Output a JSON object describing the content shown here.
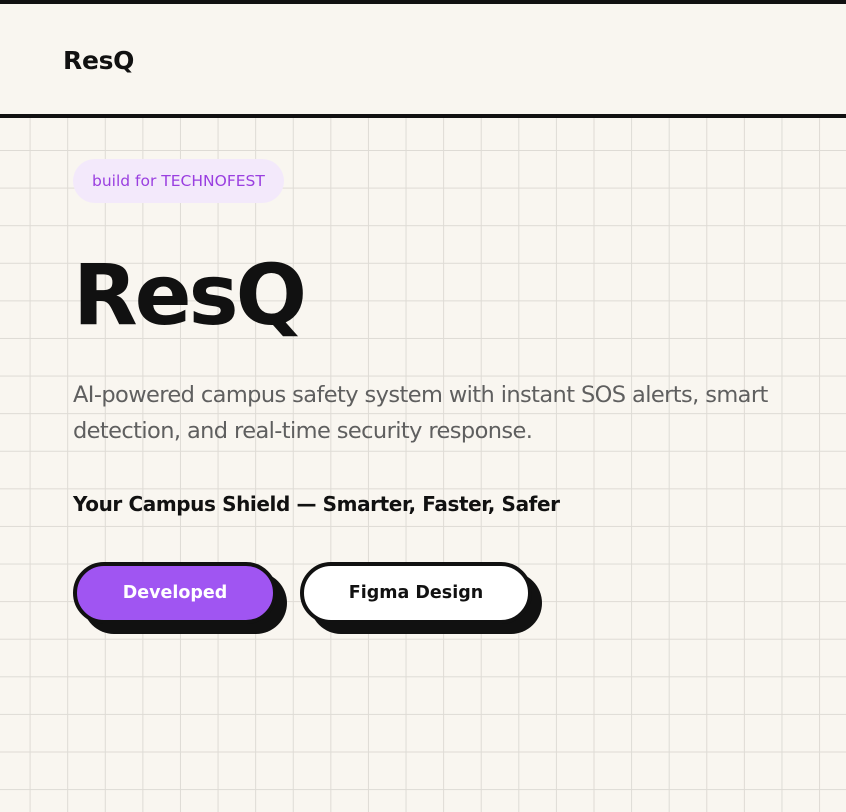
{
  "nav": {
    "brand": "ResQ"
  },
  "hero": {
    "badge": "build for TECHNOFEST",
    "title": "ResQ",
    "description": "AI-powered campus safety system with instant SOS alerts, smart detection, and real-time security response.",
    "tagline": "Your Campus Shield — Smarter, Faster, Safer",
    "buttons": {
      "primary_label": "Developed",
      "secondary_label": "Figma Design"
    }
  },
  "colors": {
    "background": "#f9f6f0",
    "grid_line": "#dedbd5",
    "accent": "#a055f2",
    "badge_bg": "#f3e9fb",
    "badge_text": "#9a3fe0",
    "ink": "#111111",
    "muted_text": "#5f5f5f"
  }
}
